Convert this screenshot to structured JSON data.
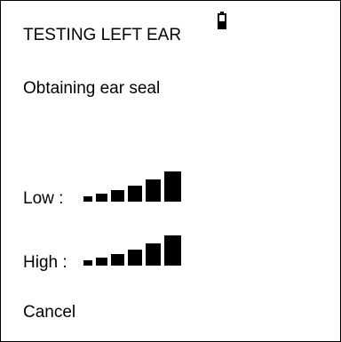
{
  "screen": {
    "title": "TESTING LEFT EAR",
    "status": "Obtaining ear seal",
    "battery_icon": "battery-icon",
    "low": {
      "label": "Low :",
      "level": "5 of 5 bars",
      "icon": "signal-level-icon"
    },
    "high": {
      "label": "High :",
      "level": "5 of 5 bars",
      "icon": "signal-level-icon"
    },
    "cancel_label": "Cancel"
  }
}
